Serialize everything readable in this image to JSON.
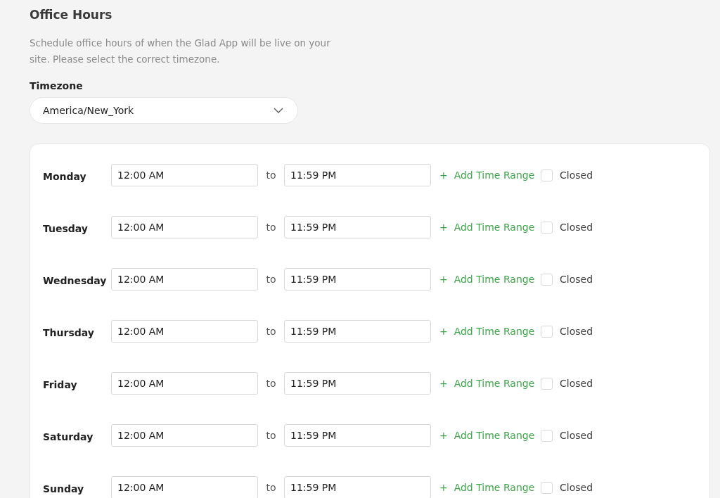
{
  "title": "Office Hours",
  "description": "Schedule office hours of when the Glad App will be live on your site. Please select the correct timezone.",
  "timezone": {
    "label": "Timezone",
    "value": "America/New_York"
  },
  "days": [
    {
      "day": "Monday",
      "from": "12:00 AM",
      "separator": "to",
      "to": "11:59 PM",
      "add_label": "+  Add Time Range",
      "closed_label": "Closed",
      "closed": false
    },
    {
      "day": "Tuesday",
      "from": "12:00 AM",
      "separator": "to",
      "to": "11:59 PM",
      "add_label": "+  Add Time Range",
      "closed_label": "Closed",
      "closed": false
    },
    {
      "day": "Wednesday",
      "from": "12:00 AM",
      "separator": "to",
      "to": "11:59 PM",
      "add_label": "+  Add Time Range",
      "closed_label": "Closed",
      "closed": false
    },
    {
      "day": "Thursday",
      "from": "12:00 AM",
      "separator": "to",
      "to": "11:59 PM",
      "add_label": "+  Add Time Range",
      "closed_label": "Closed",
      "closed": false
    },
    {
      "day": "Friday",
      "from": "12:00 AM",
      "separator": "to",
      "to": "11:59 PM",
      "add_label": "+  Add Time Range",
      "closed_label": "Closed",
      "closed": false
    },
    {
      "day": "Saturday",
      "from": "12:00 AM",
      "separator": "to",
      "to": "11:59 PM",
      "add_label": "+  Add Time Range",
      "closed_label": "Closed",
      "closed": false
    },
    {
      "day": "Sunday",
      "from": "12:00 AM",
      "separator": "to",
      "to": "11:59 PM",
      "add_label": "+  Add Time Range",
      "closed_label": "Closed",
      "closed": false
    }
  ]
}
